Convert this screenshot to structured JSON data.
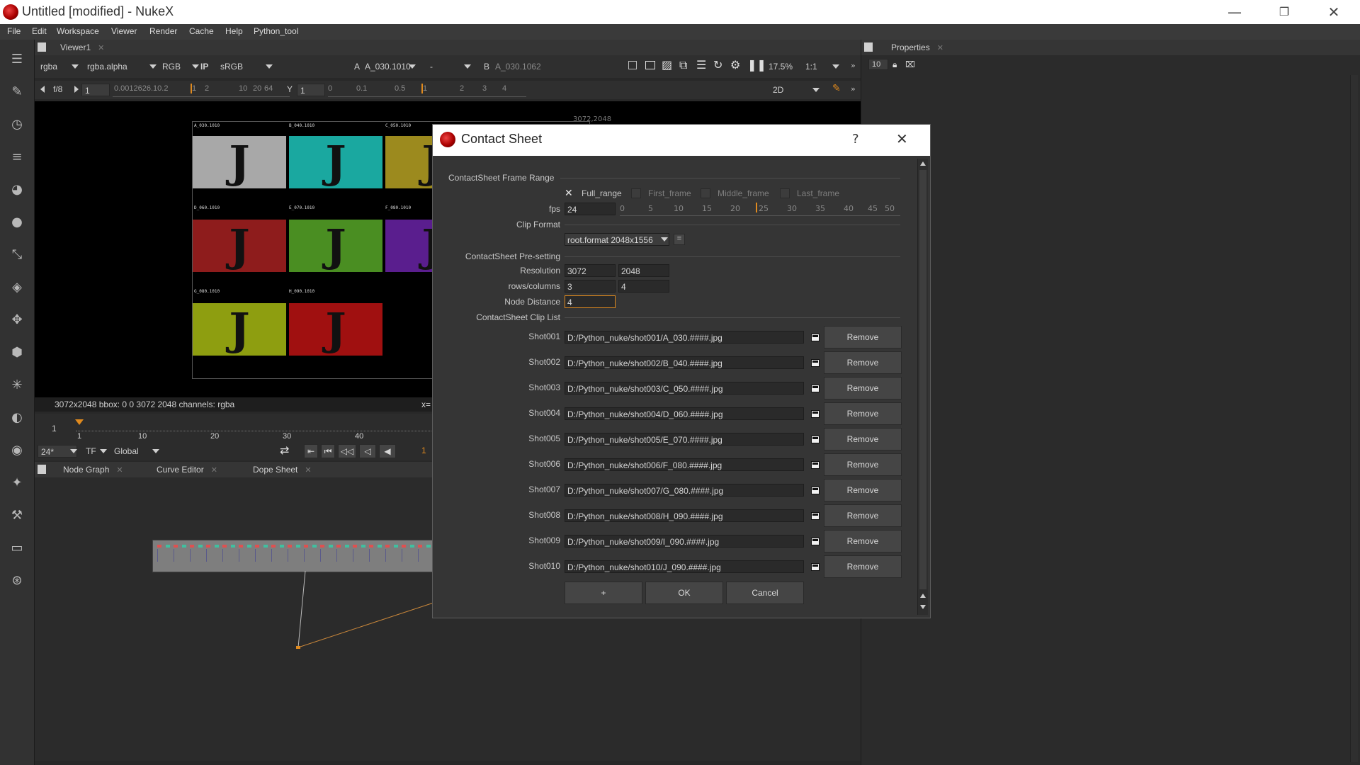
{
  "window": {
    "title": "Untitled [modified] - NukeX",
    "minimize": "—",
    "maximize": "❐",
    "close": "✕"
  },
  "menu": [
    "File",
    "Edit",
    "Workspace",
    "Viewer",
    "Render",
    "Cache",
    "Help",
    "Python_tool"
  ],
  "viewer_tab": {
    "label": "Viewer1"
  },
  "viewer_toolbar": {
    "channels": "rgba",
    "alpha": "rgba.alpha",
    "display": "RGB",
    "ip": "IP",
    "colorspace": "sRGB",
    "a_label": "A",
    "a_input": "A_030.1010",
    "blend": "-",
    "b_label": "B",
    "b_input": "A_030.1062",
    "zoom": "17.5%",
    "ratio": "1:1",
    "fstop": "f/8",
    "gain": "1",
    "gain_scale": "0.0012626.10.2",
    "gain_ticks": [
      "1",
      "2",
      "10",
      "20",
      "64"
    ],
    "y_label": "Y",
    "gamma": "1",
    "gamma_ticks": [
      "0",
      "0.1",
      "0.5",
      "1",
      "2",
      "3",
      "4"
    ],
    "view_mode": "2D"
  },
  "viewer": {
    "format_label": "3072,2048",
    "tiles": [
      {
        "label": "A_030.1010",
        "color": "#a8a8a8",
        "glyph": "J"
      },
      {
        "label": "B_040.1010",
        "color": "#1aa8a0",
        "glyph": "J"
      },
      {
        "label": "C_050.1010",
        "color": "#9c8a1e",
        "glyph": "J"
      },
      {
        "label": "D_060.1010",
        "color": "#8e1c1c",
        "glyph": "J"
      },
      {
        "label": "E_070.1010",
        "color": "#4a8e22",
        "glyph": "J"
      },
      {
        "label": "F_080.1010",
        "color": "#5a1e8e",
        "glyph": "J"
      },
      {
        "label": "G_080.1010",
        "color": "#8e9e10",
        "glyph": "J"
      },
      {
        "label": "H_090.1010",
        "color": "#a01010",
        "glyph": "J"
      }
    ],
    "status": "3072x2048  bbox: 0 0 3072 2048 channels: rgba",
    "status_right": "x="
  },
  "timeline": {
    "start": "1",
    "ticks": [
      "1",
      "10",
      "20",
      "30",
      "40"
    ],
    "fps": "24*",
    "tf": "TF",
    "range": "Global",
    "current_frame": "1"
  },
  "node_graph_tabs": [
    {
      "label": "Node Graph"
    },
    {
      "label": "Curve Editor"
    },
    {
      "label": "Dope Sheet"
    }
  ],
  "properties": {
    "tab": "Properties",
    "max_panels": "10"
  },
  "dialog": {
    "title": "Contact Sheet",
    "help": "?",
    "close": "✕",
    "frame_range_section": "ContactSheet Frame Range",
    "options": [
      {
        "label": "Full_range",
        "checked": true
      },
      {
        "label": "First_frame",
        "checked": false
      },
      {
        "label": "Middle_frame",
        "checked": false
      },
      {
        "label": "Last_frame",
        "checked": false
      }
    ],
    "fps_label": "fps",
    "fps_value": "24",
    "fps_ticks": [
      "0",
      "5",
      "10",
      "15",
      "20",
      "25",
      "30",
      "35",
      "40",
      "45",
      "50"
    ],
    "clip_format_label": "Clip Format",
    "clip_format_value": "root.format 2048x1556",
    "clip_format_eq": "=",
    "presetting_section": "ContactSheet Pre-setting",
    "resolution_label": "Resolution",
    "resolution_w": "3072",
    "resolution_h": "2048",
    "rows_columns_label": "rows/columns",
    "rows": "3",
    "columns": "4",
    "node_distance_label": "Node Distance",
    "node_distance": "4",
    "clip_list_section": "ContactSheet Clip List",
    "remove_label": "Remove",
    "clips": [
      {
        "name": "Shot001",
        "path": "D:/Python_nuke/shot001/A_030.####.jpg"
      },
      {
        "name": "Shot002",
        "path": "D:/Python_nuke/shot002/B_040.####.jpg"
      },
      {
        "name": "Shot003",
        "path": "D:/Python_nuke/shot003/C_050.####.jpg"
      },
      {
        "name": "Shot004",
        "path": "D:/Python_nuke/shot004/D_060.####.jpg"
      },
      {
        "name": "Shot005",
        "path": "D:/Python_nuke/shot005/E_070.####.jpg"
      },
      {
        "name": "Shot006",
        "path": "D:/Python_nuke/shot006/F_080.####.jpg"
      },
      {
        "name": "Shot007",
        "path": "D:/Python_nuke/shot007/G_080.####.jpg"
      },
      {
        "name": "Shot008",
        "path": "D:/Python_nuke/shot008/H_090.####.jpg"
      },
      {
        "name": "Shot009",
        "path": "D:/Python_nuke/shot009/I_090.####.jpg"
      },
      {
        "name": "Shot010",
        "path": "D:/Python_nuke/shot010/J_090.####.jpg"
      }
    ],
    "add_label": "+",
    "ok_label": "OK",
    "cancel_label": "Cancel"
  },
  "colors": {
    "accent": "#e08a1e",
    "background": "#282828",
    "panel": "#353535"
  }
}
